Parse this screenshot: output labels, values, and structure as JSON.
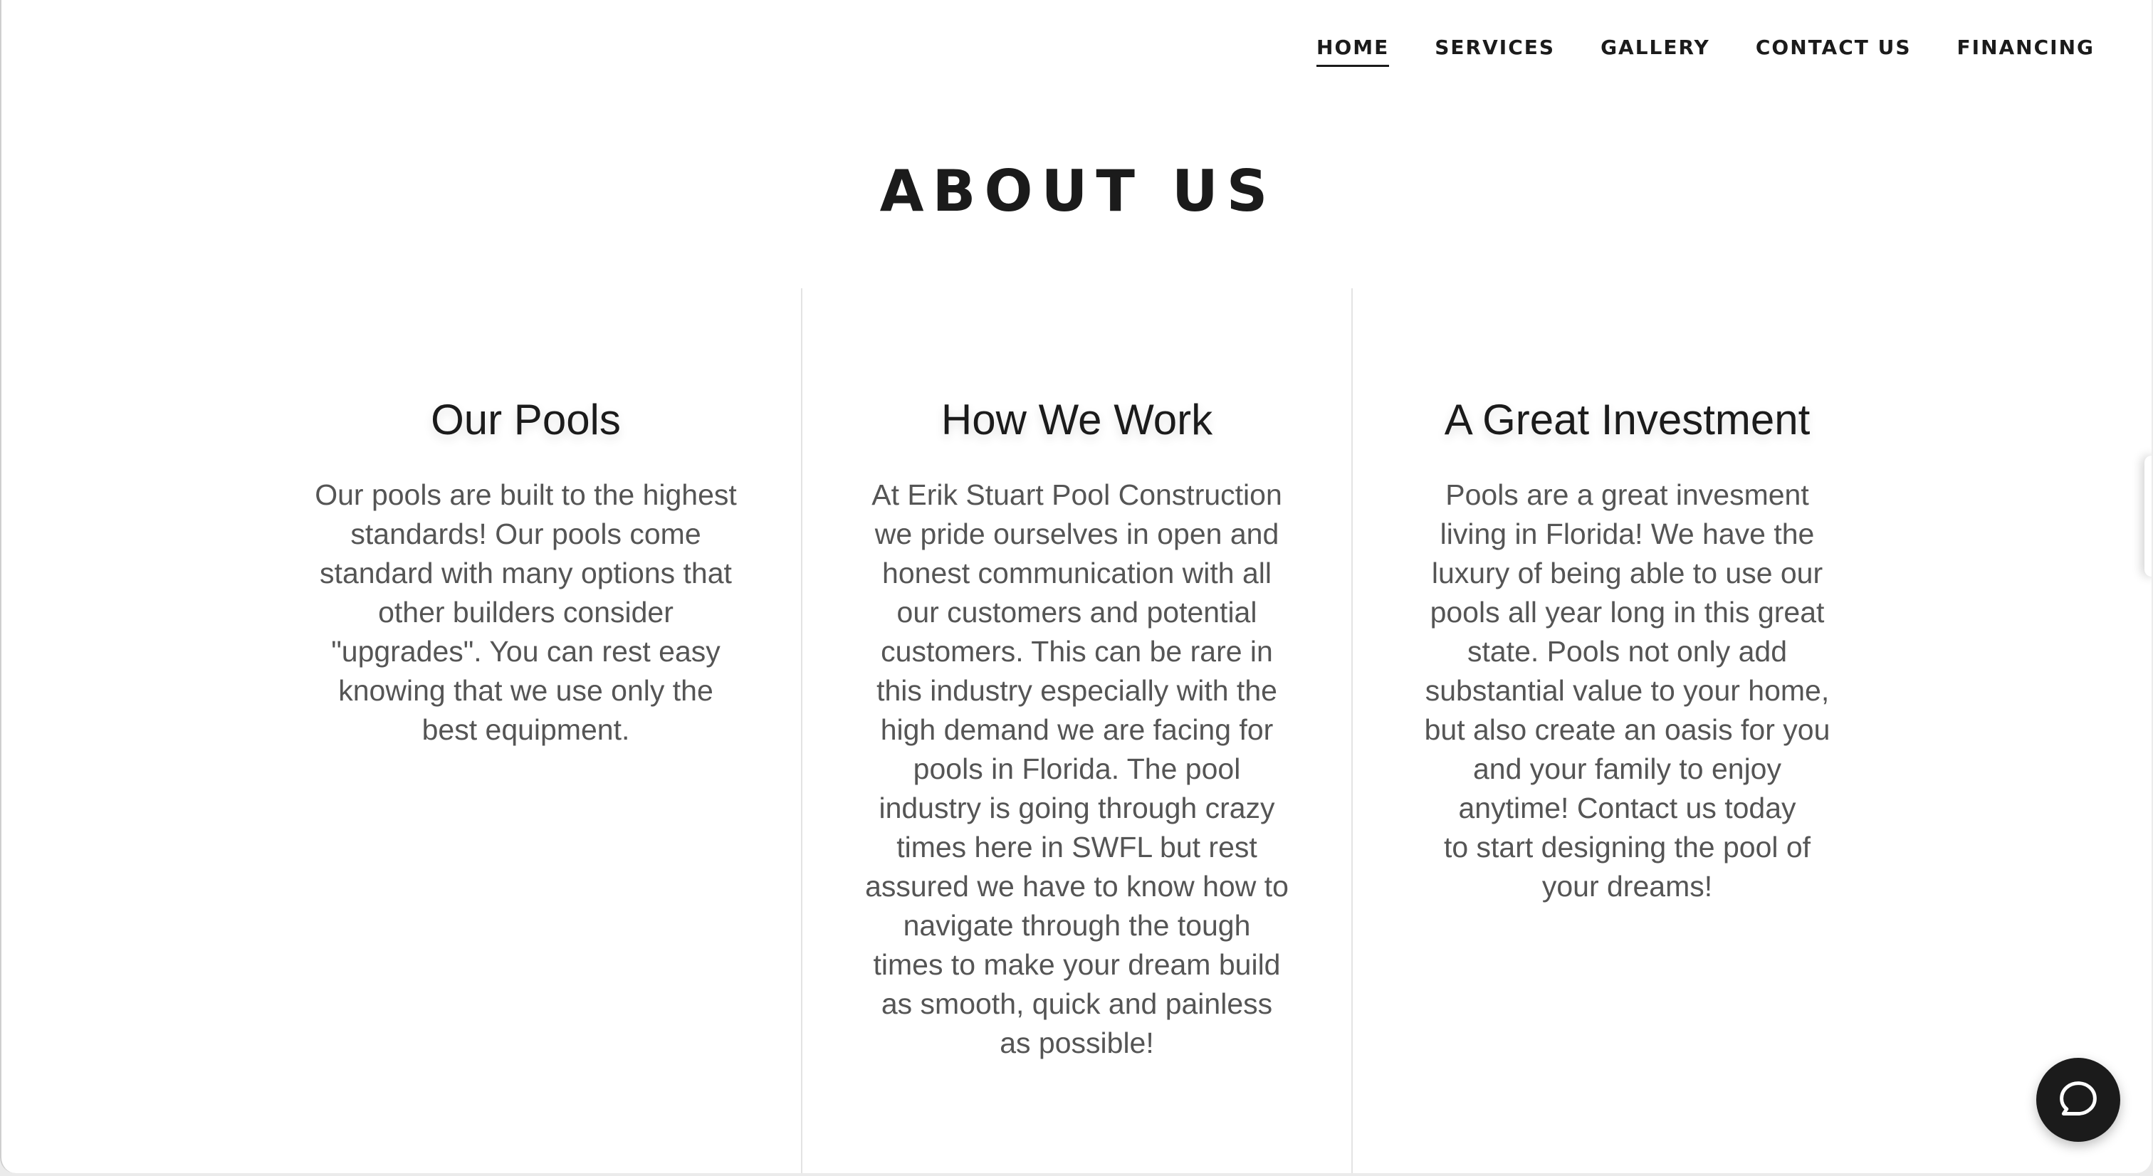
{
  "nav": {
    "items": [
      {
        "label": "HOME",
        "active": true
      },
      {
        "label": "SERVICES",
        "active": false
      },
      {
        "label": "GALLERY",
        "active": false
      },
      {
        "label": "CONTACT US",
        "active": false
      },
      {
        "label": "FINANCING",
        "active": false
      }
    ]
  },
  "about": {
    "title": "ABOUT US",
    "columns": [
      {
        "title": "Our Pools",
        "text": "Our pools are built to the highest\nstandards! Our pools come\nstandard with many options that\nother builders consider\n\"upgrades\".  You can rest easy\nknowing that we use only the\nbest equipment."
      },
      {
        "title": "How We Work",
        "text": "At Erik Stuart Pool Construction\nwe pride ourselves in open and\nhonest communication with all\nour customers and potential\ncustomers. This can be rare in\nthis industry especially with the\nhigh demand we are facing for\npools in Florida. The pool\nindustry is going through crazy\ntimes here in SWFL but rest\nassured we have to know how to\nnavigate through the tough\ntimes to make your dream build\nas smooth, quick and painless\nas possible!"
      },
      {
        "title": "A Great Investment",
        "text": "Pools are a great invesment\nliving in Florida! We have the\nluxury of being able to use our\npools all year long in this great\nstate. Pools not only add\nsubstantial value to your home,\nbut also create an oasis for you\nand your family to enjoy\nanytime! Contact us today\nto start designing the pool of\nyour dreams!"
      }
    ]
  },
  "chat": {
    "icon": "chat-bubble-icon",
    "color": "#1b1b1b"
  }
}
